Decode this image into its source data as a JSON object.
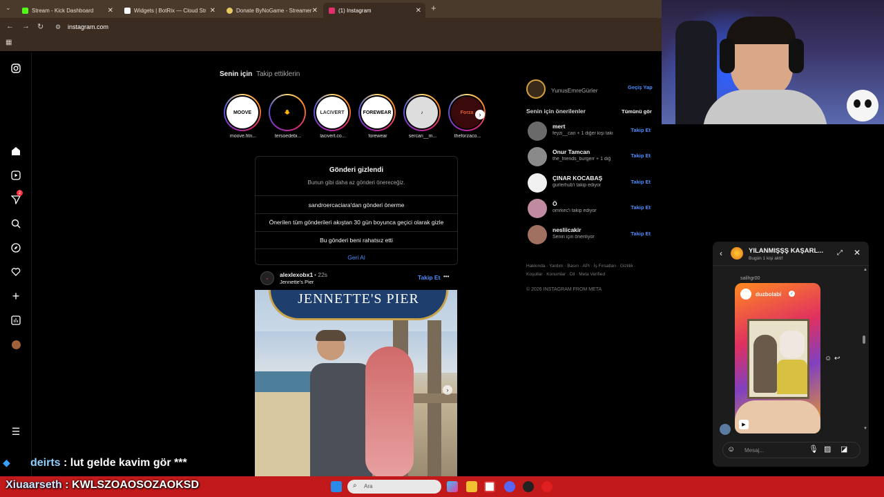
{
  "browser": {
    "tabs": [
      {
        "title": "Stream - Kick Dashboard",
        "color": "#53fc18"
      },
      {
        "title": "Widgets | BotRix — Cloud Strea",
        "color": "#ffffff"
      },
      {
        "title": "Donate ByNoGame - Streamer",
        "color": "#e8c860"
      },
      {
        "title": "(1) Instagram",
        "color": "#e1306c"
      }
    ],
    "new_tab": "+",
    "url": "instagram.com"
  },
  "feed": {
    "tab_for_you": "Senin için",
    "tab_following": "Takip ettiklerin",
    "stories": [
      {
        "name": "moove.fitn...",
        "label": "MOOVE",
        "bg": "#ffffff",
        "fg": "#000000"
      },
      {
        "name": "tersoedebi...",
        "label": "🐥",
        "bg": "#000000",
        "fg": "#ffcc00"
      },
      {
        "name": "lacivert.co...",
        "label": "LACIVERT",
        "bg": "#ffffff",
        "fg": "#333333"
      },
      {
        "name": "forewear",
        "label": "FOREWEAR",
        "bg": "#ffffff",
        "fg": "#000000"
      },
      {
        "name": "sercan__m...",
        "label": "♪",
        "bg": "#dddddd",
        "fg": "#000000"
      },
      {
        "name": "theforzaco...",
        "label": "Forza",
        "bg": "#3a0a0a",
        "fg": "#e06030"
      }
    ],
    "hidden_card": {
      "title": "Gönderi gizlendi",
      "subtitle": "Bunun gibi daha az gönderi önereceğiz.",
      "options": [
        "sandroercaciara'dan gönderi önerme",
        "Önerilen tüm gönderileri akıştan 30 gün boyunca geçici olarak gizle",
        "Bu gönderi beni rahatsız etti"
      ],
      "undo": "Geri Al"
    },
    "post": {
      "username": "alexlexobx1",
      "time": "• 22s",
      "location": "Jennette's Pier",
      "follow": "Takip Et",
      "more": "•••",
      "sign_text": "JENNETTE'S PIER"
    }
  },
  "sidebar": {
    "profile_name": "YunusEmreGürler",
    "switch": "Geçiş Yap",
    "suggestions_title": "Senin için önerilenler",
    "see_all": "Tümünü gör",
    "suggestions": [
      {
        "name": "mert",
        "sub": "feyzi__can + 1 diğer kişi taki",
        "follow": "Takip Et",
        "av": "#6a6a6a"
      },
      {
        "name": "Onur Tamcan",
        "sub": "the_friends_burgerr + 1 diğ",
        "follow": "Takip Et",
        "av": "#8a8a8a"
      },
      {
        "name": "ÇINAR KOCABAŞ",
        "sub": "gurlerhub'i takip ediyor",
        "follow": "Takip Et",
        "av": "#f0f0f0"
      },
      {
        "name": "Ö",
        "sub": "omrkec'i takip ediyor",
        "follow": "Takip Et",
        "av": "#c08aa0"
      },
      {
        "name": "nesliicakir",
        "sub": "Senin için öneriliyor",
        "follow": "Takip Et",
        "av": "#a07060"
      }
    ],
    "footer_links": "Hakkında · Yardım · Basın · API · İş Fırsatları · Gizlilik · Koşullar · Konumlar · Dil · Meta Verified",
    "copyright": "© 2026 INSTAGRAM FROM META"
  },
  "dm": {
    "title": "YILANMIŞŞŞ KAŞARL...",
    "status": "Bugün 1 kişi aktif",
    "sender": "salihgr00",
    "shared_account": "duzbolabi",
    "message_placeholder": "Mesaj..."
  },
  "chat": {
    "line1_user": "deirts",
    "line1_text": ": lut gelde kavim gör ***",
    "line2_user": "Xiuaarseth",
    "line2_text": ": KWLSZOAOSOZAOKSD"
  },
  "taskbar": {
    "search_placeholder": "Ara"
  }
}
